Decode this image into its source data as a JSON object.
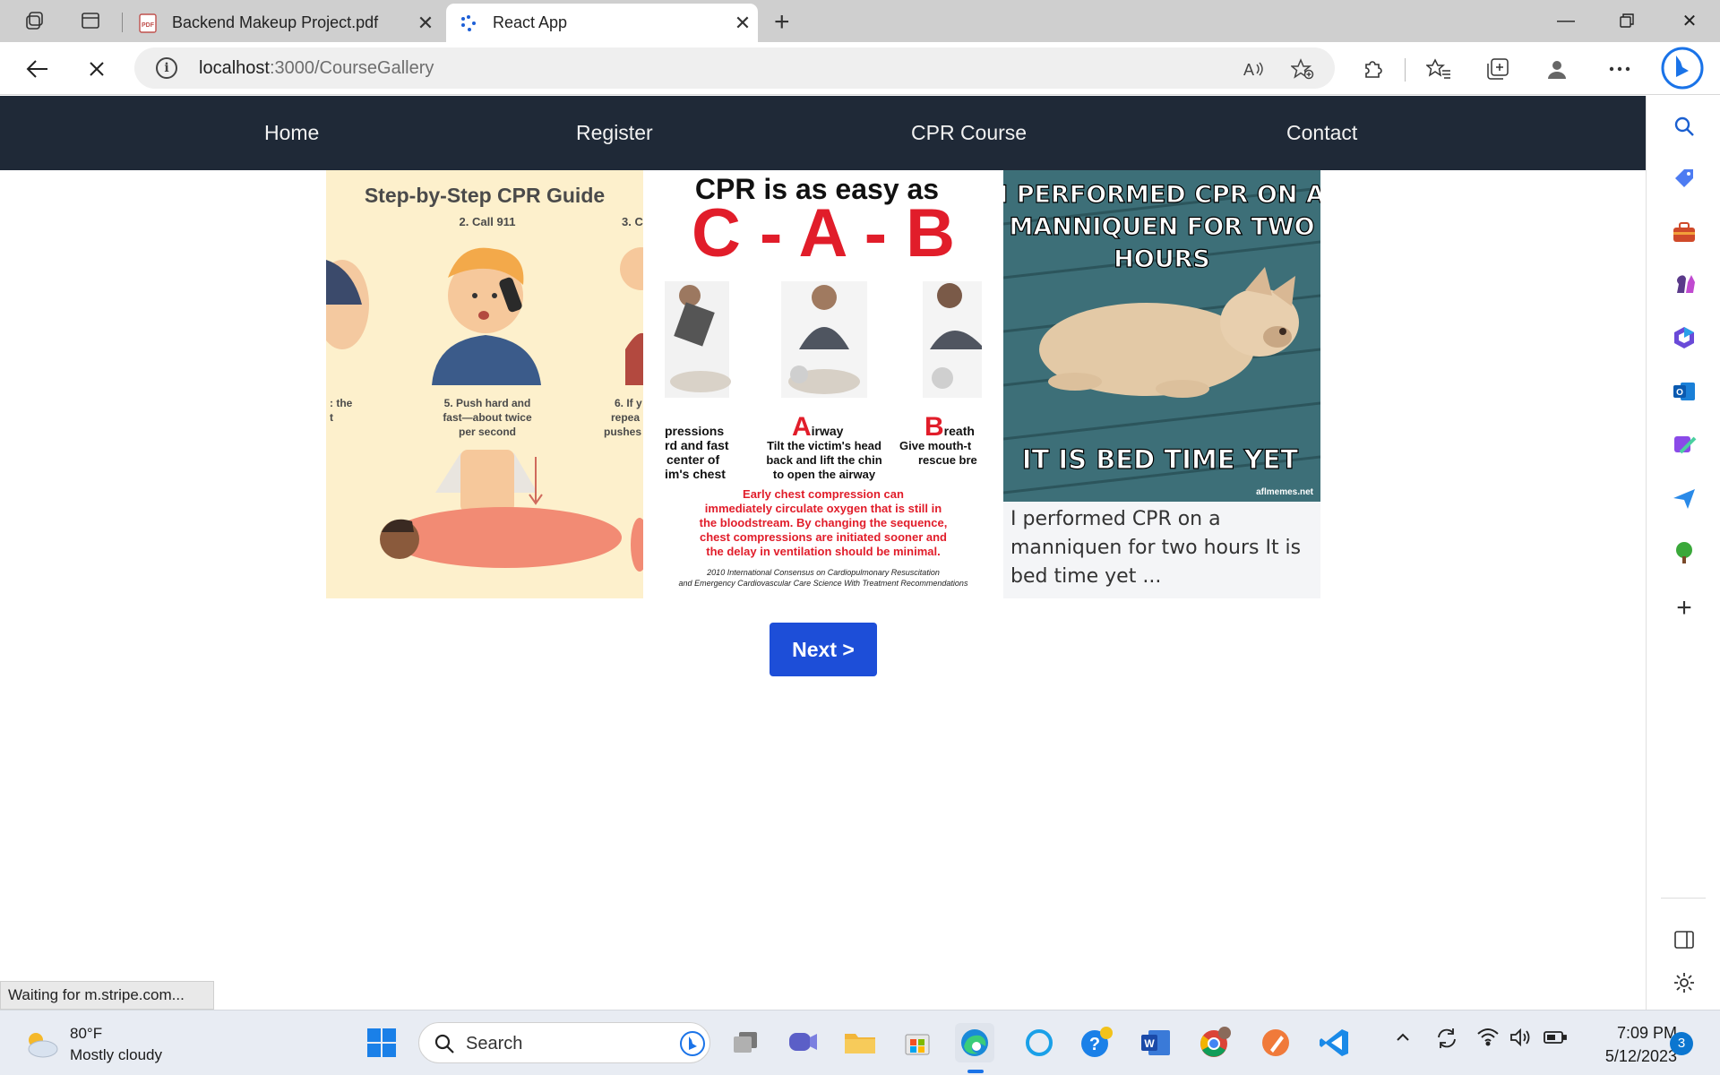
{
  "browser": {
    "tabs": [
      {
        "title": "Backend Makeup Project.pdf",
        "active": false,
        "icon": "pdf-icon"
      },
      {
        "title": "React App",
        "active": true,
        "icon": "react-dots-icon"
      }
    ],
    "url_host": "localhost",
    "url_path": ":3000/CourseGallery",
    "status_text": "Waiting for m.stripe.com..."
  },
  "site": {
    "nav": [
      "Home",
      "Register",
      "CPR Course",
      "Contact"
    ],
    "next_label": "Next >"
  },
  "gallery": {
    "card1": {
      "title": "Step-by-Step CPR Guide",
      "step2": "2. Call 911",
      "step3": "3. Cl",
      "step5": "5. Push hard and fast—about twice per second",
      "step6": "6. If y repea pushes",
      "left_cut": ": the t"
    },
    "card2": {
      "heading": "CPR is as easy as",
      "letters": "C - A - B",
      "col1": "pressions rd and fast center of im's chest",
      "airway_title": "Airway",
      "airway": "Tilt the victim's head back and lift the chin to open the airway",
      "breath_title": "Breath",
      "breath": "Give mouth-t rescue bre",
      "note": "Early chest compression can immediately circulate oxygen that is still in the bloodstream. By changing the sequence, chest compressions are initiated sooner and the delay in ventilation should be minimal.",
      "source": "2010 International Consensus on Cardiopulmonary Resuscitation and Emergency Cardiovascular Care Science With Treatment Recommendations"
    },
    "card3": {
      "top_text": "I PERFORMED CPR ON A MANNIQUEN FOR TWO HOURS",
      "bottom_text": "IT IS BED TIME YET",
      "watermark": "aflmemes.net",
      "caption": "I performed CPR on a manniquen for two hours It is bed time yet ..."
    }
  },
  "taskbar": {
    "temp": "80°F",
    "weather": "Mostly cloudy",
    "search_placeholder": "Search",
    "time": "7:09 PM",
    "date": "5/12/2023",
    "notifications": "3"
  }
}
